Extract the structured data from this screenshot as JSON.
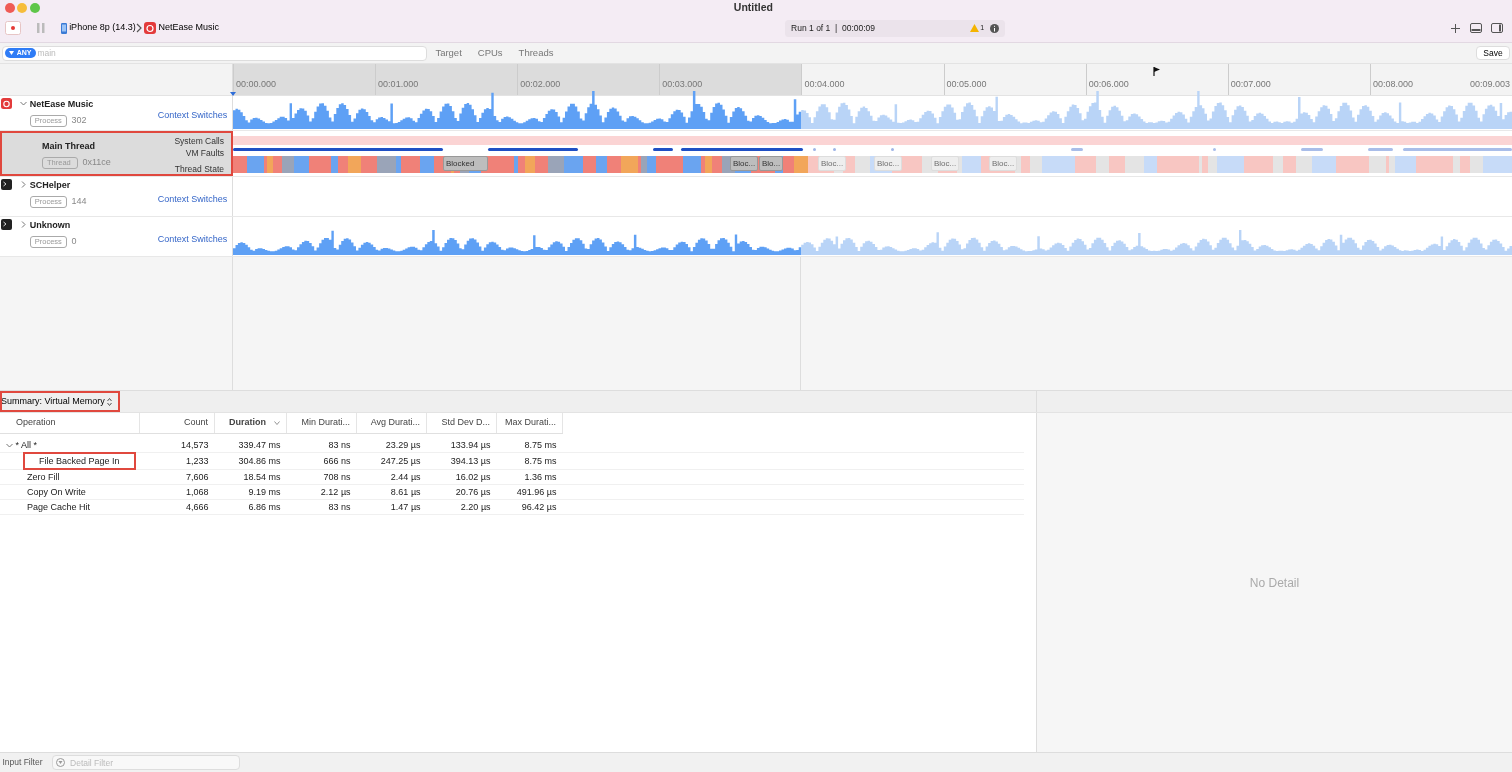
{
  "window": {
    "title": "Untitled"
  },
  "toolbar": {
    "device": "iPhone 8p (14.3)",
    "app": "NetEase Music",
    "run_status": "Run 1 of 1  |  00:00:09",
    "warning_count": "1"
  },
  "filter_bar": {
    "badge": "ANY",
    "placeholder": "main",
    "tabs": [
      {
        "label": "Target",
        "selected": false
      },
      {
        "label": "CPUs",
        "selected": false
      },
      {
        "label": "Threads",
        "selected": false
      }
    ],
    "save": "Save"
  },
  "ruler": {
    "ticks": [
      {
        "label": "00:00.000",
        "in_range": true
      },
      {
        "label": "00:01.000",
        "in_range": true
      },
      {
        "label": "00:02.000",
        "in_range": true
      },
      {
        "label": "00:03.000",
        "in_range": true
      },
      {
        "label": "00:04.000",
        "in_range": false
      },
      {
        "label": "00:05.000",
        "in_range": false
      },
      {
        "label": "00:06.000",
        "in_range": false
      },
      {
        "label": "00:07.000",
        "in_range": false
      },
      {
        "label": "00:08.000",
        "in_range": false
      }
    ],
    "end_label": "00:09.003"
  },
  "tracks": [
    {
      "kind": "process",
      "name": "NetEase Music",
      "tag": "Process",
      "count": "302",
      "lane": "Context Switches",
      "expanded": true
    },
    {
      "kind": "thread",
      "name": "Main Thread",
      "tag": "Thread",
      "count": "0x11ce",
      "lanes": [
        "System Calls",
        "VM Faults",
        "Thread State"
      ],
      "selected": true,
      "highlighted": true,
      "state_labels": [
        {
          "text": "Blocked",
          "dimmed": false
        },
        {
          "text": "Bloc...",
          "dimmed": false
        },
        {
          "text": "Blo...",
          "dimmed": false
        },
        {
          "text": "Bloc...",
          "dimmed": true
        },
        {
          "text": "Bloc...",
          "dimmed": true
        },
        {
          "text": "Bloc...",
          "dimmed": true
        },
        {
          "text": "Bloc...",
          "dimmed": true
        }
      ]
    },
    {
      "kind": "process",
      "name": "SCHelper",
      "tag": "Process",
      "count": "144",
      "lane": "Context Switches",
      "expanded": false
    },
    {
      "kind": "process",
      "name": "Unknown",
      "tag": "Process",
      "count": "0",
      "lane": "Context Switches",
      "expanded": false
    }
  ],
  "summary": {
    "selector": "Summary: Virtual Memory",
    "highlighted": true
  },
  "table": {
    "columns": [
      {
        "label": "Operation",
        "sorted": false
      },
      {
        "label": "Count",
        "sorted": false
      },
      {
        "label": "Duration",
        "sorted": true
      },
      {
        "label": "Min Durati...",
        "sorted": false
      },
      {
        "label": "Avg Durati...",
        "sorted": false
      },
      {
        "label": "Std Dev D...",
        "sorted": false
      },
      {
        "label": "Max Durati...",
        "sorted": false
      }
    ],
    "rows": [
      {
        "cells": [
          "* All *",
          "14,573",
          "339.47 ms",
          "83 ns",
          "23.29 µs",
          "133.94 µs",
          "8.75 ms"
        ],
        "expanded": true,
        "highlighted": false,
        "children": [
          {
            "cells": [
              "File Backed Page In",
              "1,233",
              "304.86 ms",
              "666 ns",
              "247.25 µs",
              "394.13 µs",
              "8.75 ms"
            ],
            "highlighted": true
          },
          {
            "cells": [
              "Zero Fill",
              "7,606",
              "18.54 ms",
              "708 ns",
              "2.44 µs",
              "16.02 µs",
              "1.36 ms"
            ],
            "highlighted": false
          },
          {
            "cells": [
              "Copy On Write",
              "1,068",
              "9.19 ms",
              "2.12 µs",
              "8.61 µs",
              "20.76 µs",
              "491.96 µs"
            ],
            "highlighted": false
          },
          {
            "cells": [
              "Page Cache Hit",
              "4,666",
              "6.86 ms",
              "83 ns",
              "1.47 µs",
              "2.20 µs",
              "96.42 µs"
            ],
            "highlighted": false
          }
        ]
      }
    ]
  },
  "detail": {
    "text": "No Detail"
  },
  "footer": {
    "label": "Input Filter",
    "placeholder": "Detail Filter"
  }
}
